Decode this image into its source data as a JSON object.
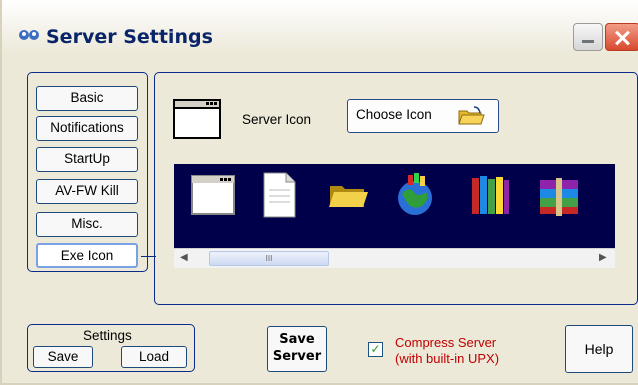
{
  "window": {
    "title": "Server Settings",
    "icon": "app-icon"
  },
  "titlebar_buttons": {
    "minimize": "minimize-icon",
    "close": "close-icon"
  },
  "nav": {
    "items": [
      {
        "label": "Basic"
      },
      {
        "label": "Notifications"
      },
      {
        "label": "StartUp"
      },
      {
        "label": "AV-FW Kill"
      },
      {
        "label": "Misc."
      },
      {
        "label": "Exe Icon",
        "active": true
      }
    ]
  },
  "main": {
    "server_icon_label": "Server Icon",
    "choose_icon_label": "Choose Icon",
    "icons": [
      "window-icon",
      "document-icon",
      "folder-icon",
      "globe-icon",
      "books-icon",
      "archive-icon"
    ],
    "scroll_thumb_grip": "III"
  },
  "settings": {
    "label": "Settings",
    "save_label": "Save",
    "load_label": "Load"
  },
  "save_server": {
    "line1": "Save",
    "line2": "Server"
  },
  "compress": {
    "checked": true,
    "line1": "Compress Server",
    "line2": "(with built-in UPX)"
  },
  "help_label": "Help",
  "colors": {
    "background": "#ece9d8",
    "title_text": "#0a246a",
    "icon_list_bg": "#00004a",
    "compress_text": "#c00000"
  }
}
